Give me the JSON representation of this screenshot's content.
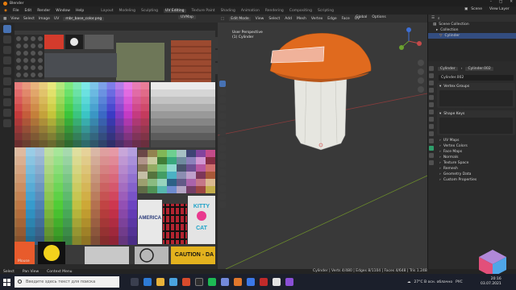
{
  "window": {
    "title": "Blender"
  },
  "menubar": {
    "menus": [
      "File",
      "Edit",
      "Render",
      "Window",
      "Help"
    ],
    "workspaces": [
      "Layout",
      "Modeling",
      "Sculpting",
      "UV Editing",
      "Texture Paint",
      "Shading",
      "Animation",
      "Rendering",
      "Compositing",
      "Scripting"
    ],
    "active_workspace": "UV Editing",
    "scene": "Scene",
    "view_layer": "View Layer"
  },
  "uv_editor": {
    "header_items": [
      "View",
      "Select",
      "Image",
      "UV"
    ],
    "image_name": "mbr_base_color.png",
    "uv_map": "UVMap",
    "status": "Mouse"
  },
  "viewport": {
    "header_items": [
      "Edit Mode",
      "View",
      "Select",
      "Add",
      "Mesh",
      "Vertex",
      "Edge",
      "Face",
      "UV"
    ],
    "orientation": "Global",
    "options": "Options",
    "info_line1": "User Perspective",
    "info_line2": "(1) Cylinder"
  },
  "outliner": {
    "header": "Scene Collection",
    "rows": [
      "Scene Collection",
      "Collection",
      "Cylinder"
    ]
  },
  "properties": {
    "object_name": "Cylinder",
    "mesh_name": "Cylinder.002",
    "data_field": "Cylinder.002",
    "panels": [
      "Vertex Groups",
      "Shape Keys"
    ],
    "sections": [
      "UV Maps",
      "Vertex Colors",
      "Face Maps",
      "Normals",
      "Texture Space",
      "Remesh",
      "Geometry Data",
      "Custom Properties"
    ]
  },
  "statusbar": {
    "items": [
      "Select",
      "Pan View",
      "Context Menu"
    ],
    "version": "Cylinder | Verts 4/480 | Edges 8/1104 | Faces 4/648 | Tris 1.248"
  },
  "taskbar": {
    "search_placeholder": "Введите здесь текст для поиска",
    "tray_weather": "27°C  В осн. облачно",
    "tray_lang": "РУС",
    "time": "20:16",
    "date": "03.07.2021"
  },
  "texture": {
    "labels": {
      "america": "AMERICA",
      "kitty": "KITTY",
      "cat": "CAT",
      "caution": "CAUTION - DA"
    }
  }
}
